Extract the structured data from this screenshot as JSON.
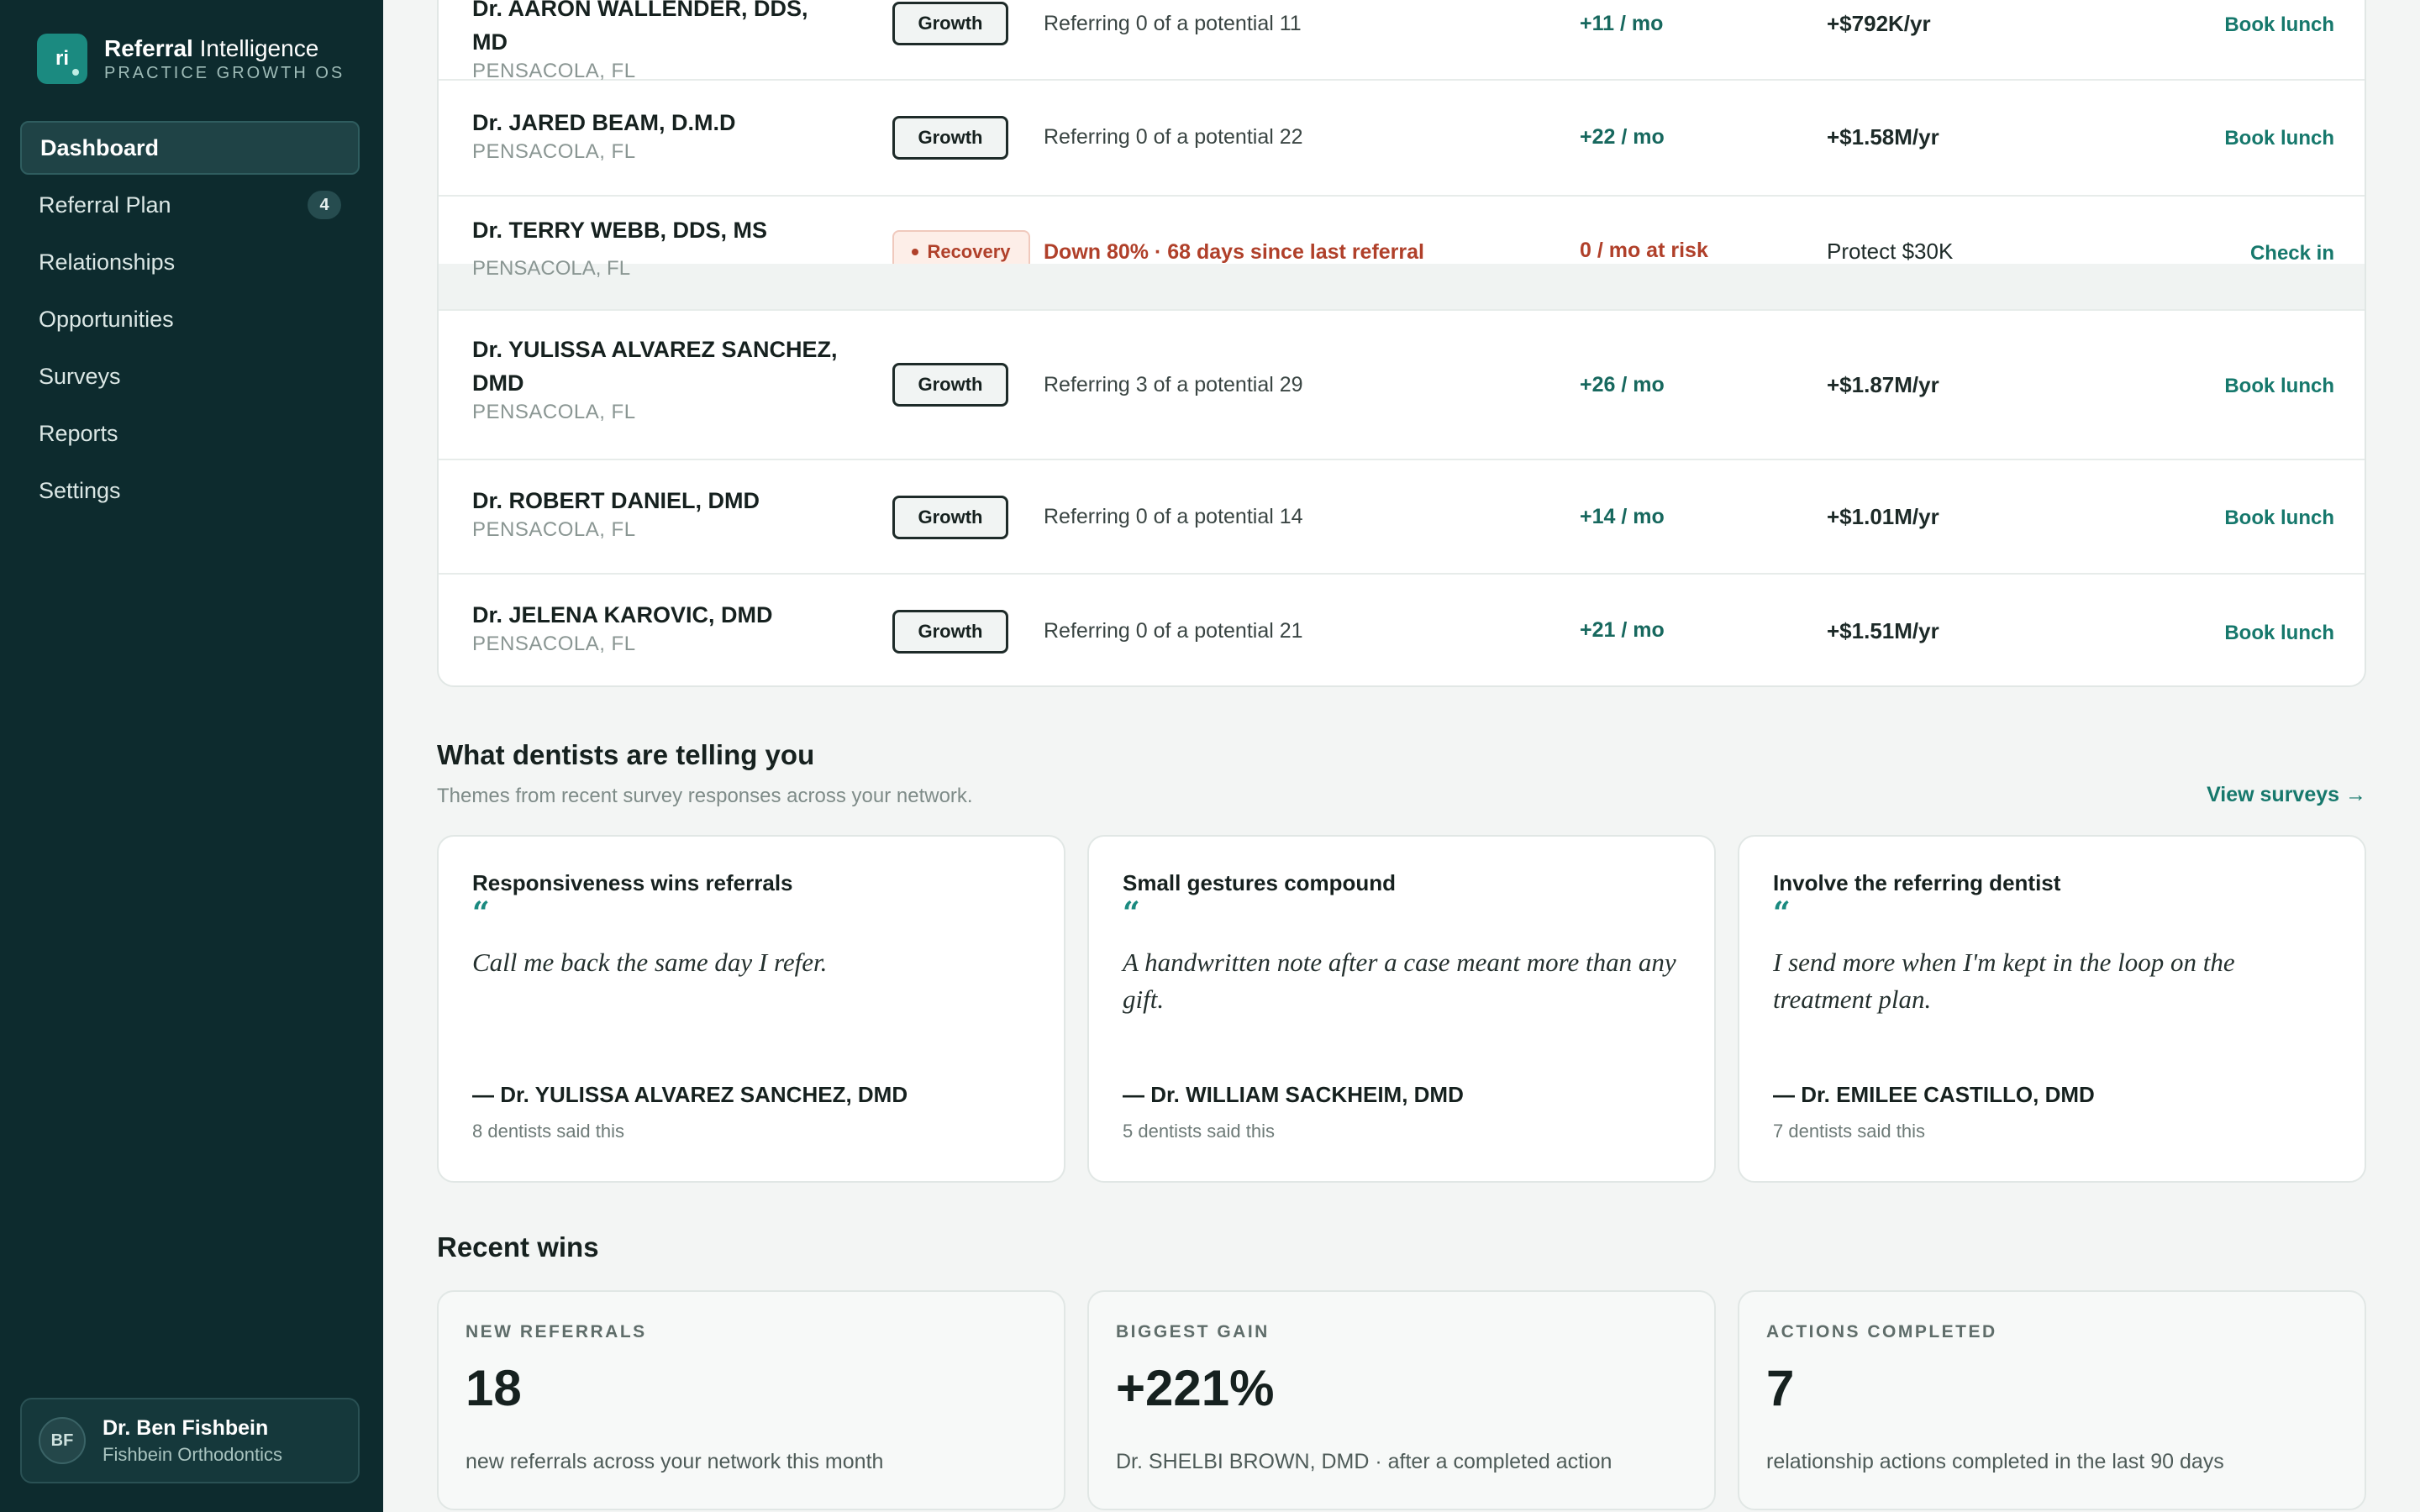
{
  "brand": {
    "logo_text": "ri",
    "name_bold": "Referral",
    "name_rest": " Intelligence",
    "tagline": "PRACTICE GROWTH OS"
  },
  "nav": {
    "items": [
      {
        "label": "Dashboard",
        "active": true
      },
      {
        "label": "Referral Plan",
        "badge": "4"
      },
      {
        "label": "Relationships"
      },
      {
        "label": "Opportunities"
      },
      {
        "label": "Surveys"
      },
      {
        "label": "Reports"
      },
      {
        "label": "Settings"
      }
    ]
  },
  "user": {
    "initials": "BF",
    "name": "Dr. Ben Fishbein",
    "org": "Fishbein Orthodontics"
  },
  "table": {
    "rows": [
      {
        "name": "Dr. AARON WALLENDER, DDS, MD",
        "location": "PENSACOLA, FL",
        "tag": "Growth",
        "status": "Referring 0 of a potential 11",
        "gain": "+11 / mo",
        "value": "+$792K/yr",
        "action": "Book lunch"
      },
      {
        "name": "Dr. JARED BEAM, D.M.D",
        "location": "PENSACOLA, FL",
        "tag": "Growth",
        "status": "Referring 0 of a potential 22",
        "gain": "+22 / mo",
        "value": "+$1.58M/yr",
        "action": "Book lunch"
      },
      {
        "name": "Dr. TERRY WEBB, DDS, MS",
        "location": "PENSACOLA, FL",
        "tag": "Recovery",
        "status": "Down 80% · 68 days since last referral",
        "gain": "0 / mo at risk",
        "value": "Protect $30K",
        "action": "Check in"
      },
      {
        "name": "Dr. YULISSA ALVAREZ SANCHEZ, DMD",
        "location": "PENSACOLA, FL",
        "tag": "Growth",
        "status": "Referring 3 of a potential 29",
        "gain": "+26 / mo",
        "value": "+$1.87M/yr",
        "action": "Book lunch"
      },
      {
        "name": "Dr. ROBERT DANIEL, DMD",
        "location": "PENSACOLA, FL",
        "tag": "Growth",
        "status": "Referring 0 of a potential 14",
        "gain": "+14 / mo",
        "value": "+$1.01M/yr",
        "action": "Book lunch"
      },
      {
        "name": "Dr. JELENA KAROVIC, DMD",
        "location": "PENSACOLA, FL",
        "tag": "Growth",
        "status": "Referring 0 of a potential 21",
        "gain": "+21 / mo",
        "value": "+$1.51M/yr",
        "action": "Book lunch"
      }
    ]
  },
  "feedback": {
    "title": "What dentists are telling you",
    "subtitle": "Themes from recent survey responses across your network.",
    "link": "View surveys →",
    "quote_mark": "“",
    "cards": [
      {
        "title": "Responsiveness wins referrals",
        "quote": "Call me back the same day I refer.",
        "author": "— Dr. YULISSA ALVAREZ SANCHEZ, DMD",
        "count": "8 dentists said this"
      },
      {
        "title": "Small gestures compound",
        "quote": "A handwritten note after a case meant more than any gift.",
        "author": "— Dr. WILLIAM SACKHEIM, DMD",
        "count": "5 dentists said this"
      },
      {
        "title": "Involve the referring dentist",
        "quote": "I send more when I'm kept in the loop on the treatment plan.",
        "author": "— Dr. EMILEE CASTILLO, DMD",
        "count": "7 dentists said this"
      }
    ]
  },
  "wins": {
    "title": "Recent wins",
    "cards": [
      {
        "label": "NEW REFERRALS",
        "value": "18",
        "desc": "new referrals across your network this month"
      },
      {
        "label": "BIGGEST GAIN",
        "value": "+221%",
        "desc": "Dr. SHELBI BROWN, DMD · after a completed action"
      },
      {
        "label": "ACTIONS COMPLETED",
        "value": "7",
        "desc": "relationship actions completed in the last 90 days"
      }
    ]
  }
}
